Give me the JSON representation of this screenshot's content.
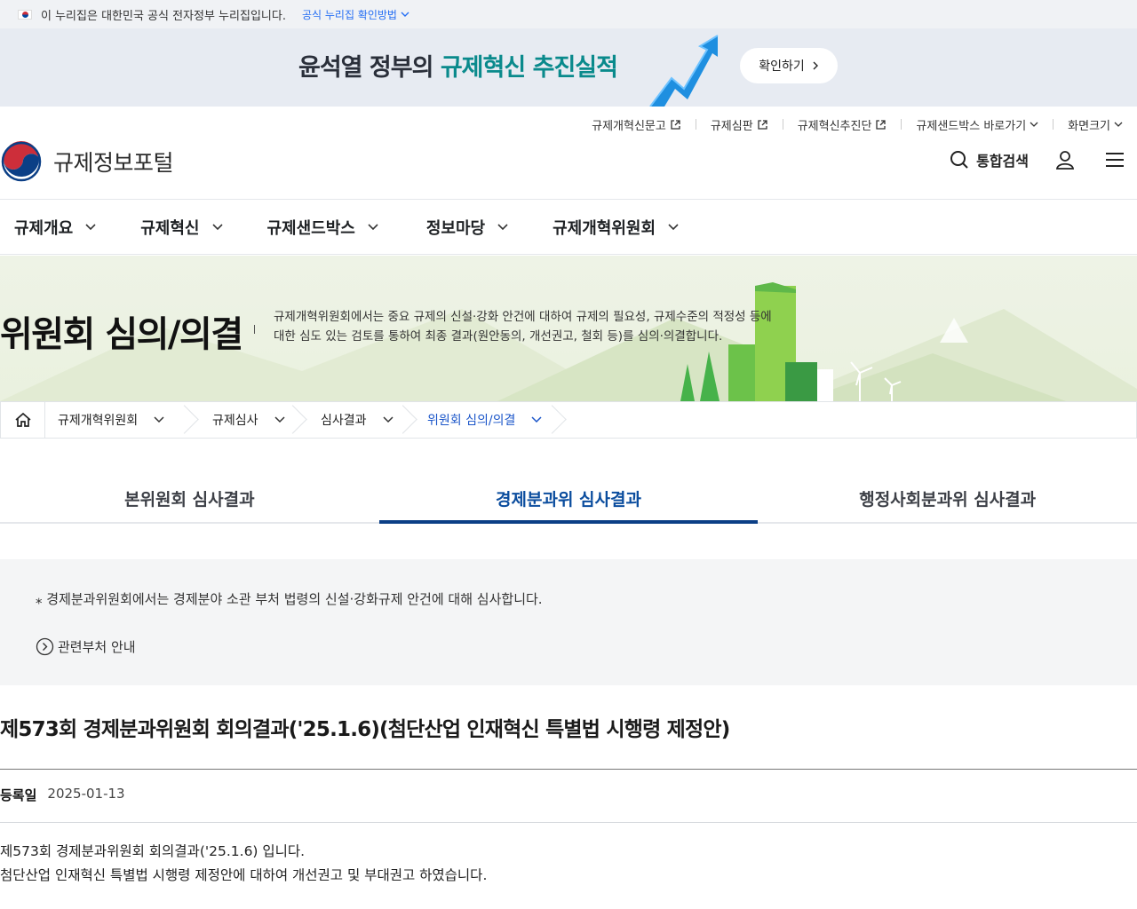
{
  "govbar": {
    "text": "이 누리집은 대한민국 공식 전자정부 누리집입니다.",
    "verify_label": "공식 누리집 확인방법"
  },
  "banner": {
    "title_a": "윤석열 정부의 ",
    "title_b": "규제혁신 추진실적",
    "button": "확인하기"
  },
  "utility": [
    "규제개혁신문고",
    "규제심판",
    "규제혁신추진단",
    "규제샌드박스 바로가기",
    "화면크기"
  ],
  "logo": {
    "name": "규제정보포털"
  },
  "header": {
    "search_label": "통합검색"
  },
  "gnb": [
    "규제개요",
    "규제혁신",
    "규제샌드박스",
    "정보마당",
    "규제개혁위원회"
  ],
  "hero": {
    "title": "위원회 심의/의결",
    "desc_line1": "규제개혁위원회에서는 중요 규제의 신설·강화 안건에 대하여 규제의 필요성, 규제수준의 적정성 등에",
    "desc_line2": "대한 심도 있는 검토를 통하여 최종 결과(원안동의, 개선권고, 철회 등)를 심의·의결합니다."
  },
  "breadcrumb": [
    "규제개혁위원회",
    "규제심사",
    "심사결과",
    "위원회 심의/의결"
  ],
  "tabs": [
    "본위원회 심사결과",
    "경제분과위 심사결과",
    "행정사회분과위 심사결과"
  ],
  "info": {
    "note": "경제분과위원회에서는 경제분야 소관 부처 법령의 신설·강화규제 안건에 대해 심사합니다.",
    "related": "관련부처 안내"
  },
  "post": {
    "title": "제573회 경제분과위원회 회의결과('25.1.6)(첨단산업 인재혁신 특별법 시행령 제정안)",
    "date_label": "등록일",
    "date": "2025-01-13",
    "body_line1": "제573회 경제분과위원회 회의결과('25.1.6) 입니다.",
    "body_line2": "첨단산업 인재혁신 특별법 시행령 제정안에 대하여 개선권고 및 부대권고 하였습니다."
  },
  "colors": {
    "accent": "#0b3f86",
    "link": "#256ef4",
    "banner_highlight": "#0a8a8c"
  },
  "icons": [
    "kr-flag-icon",
    "chevron-down-icon",
    "external-link-icon",
    "gov-emblem-icon",
    "search-icon",
    "user-icon",
    "menu-icon",
    "home-icon",
    "circle-arrow-right-icon"
  ]
}
